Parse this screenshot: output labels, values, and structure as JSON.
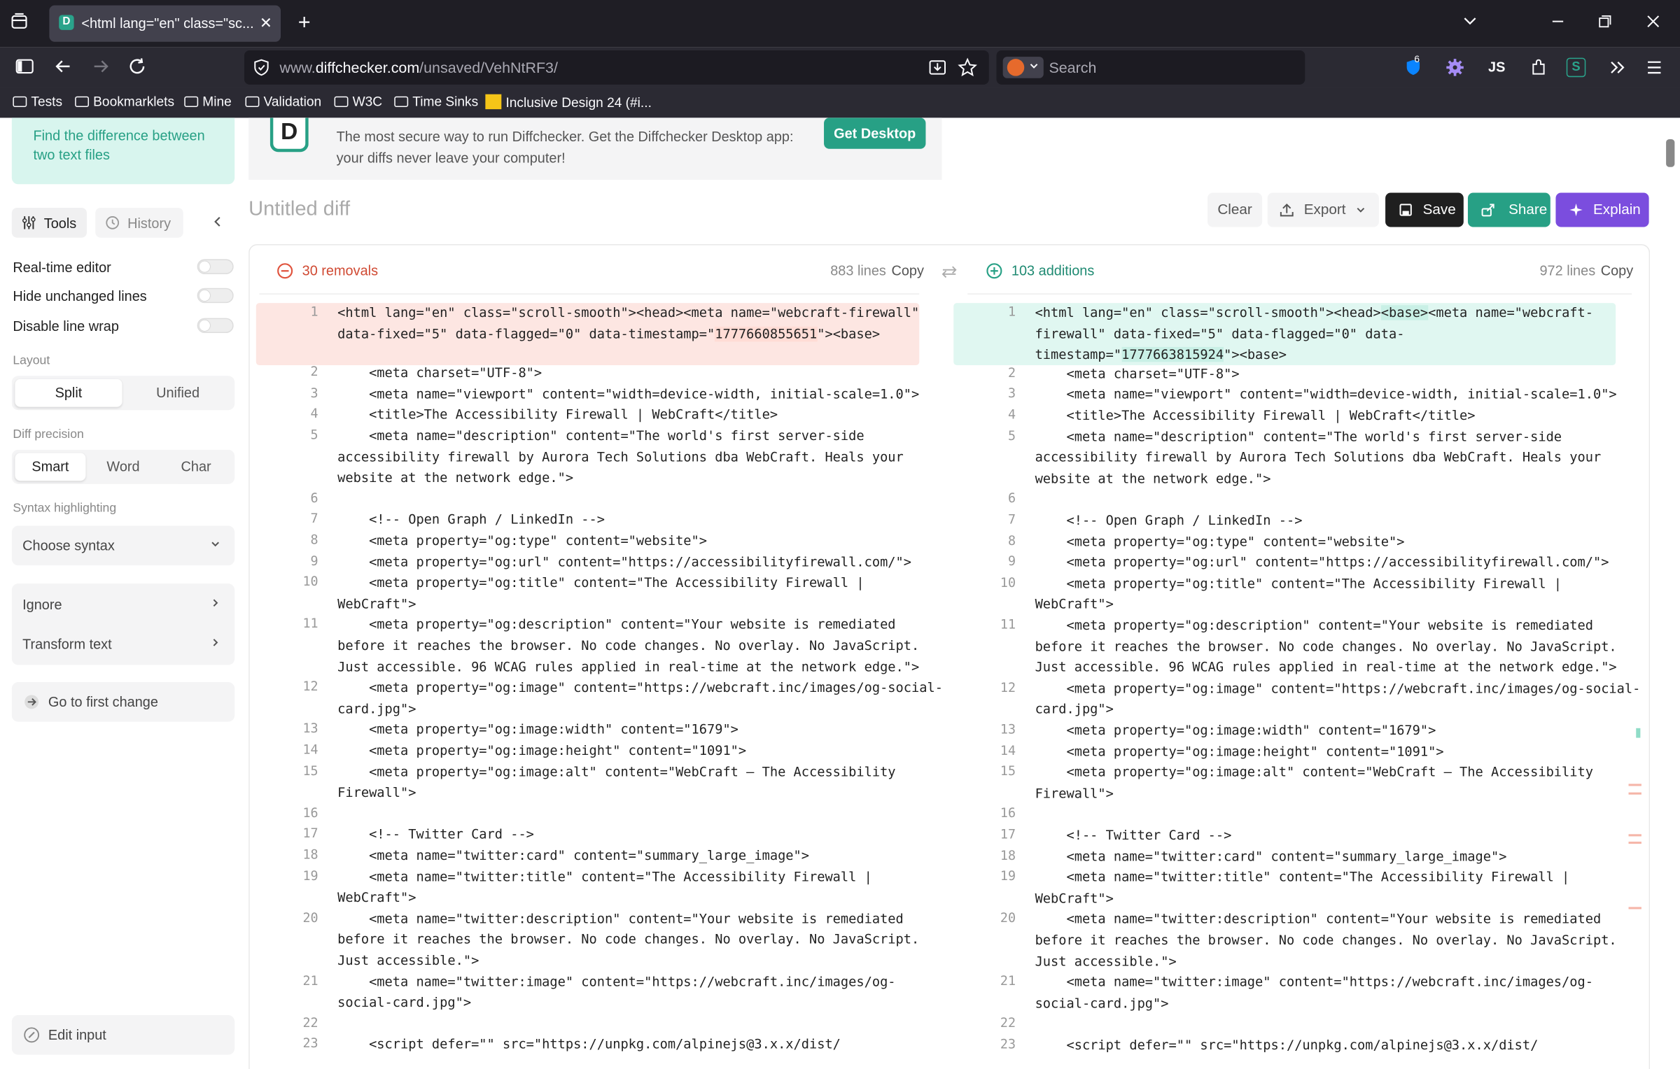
{
  "browser": {
    "tab_title": "<html lang=\"en\" class=\"sc... ↔",
    "url_prefix": "www.",
    "url_domain": "diffchecker.com",
    "url_path": "/unsaved/VehNtRF3/",
    "search_placeholder": "Search",
    "ext_badge": "6",
    "bookmarks": [
      "Tests",
      "Bookmarklets",
      "Mine",
      "Validation",
      "W3C",
      "Time Sinks",
      "Inclusive Design 24 (#i..."
    ]
  },
  "sidebar": {
    "promo_text": "Find the difference between two text files",
    "tools_label": "Tools",
    "history_label": "History",
    "toggles": [
      "Real-time editor",
      "Hide unchanged lines",
      "Disable line wrap"
    ],
    "layout_label": "Layout",
    "layout_options": [
      "Split",
      "Unified"
    ],
    "precision_label": "Diff precision",
    "precision_options": [
      "Smart",
      "Word",
      "Char"
    ],
    "syntax_label": "Syntax highlighting",
    "syntax_select": "Choose syntax",
    "ignore_label": "Ignore",
    "transform_label": "Transform text",
    "first_change_label": "Go to first change",
    "edit_input_label": "Edit input"
  },
  "banner": {
    "text": "The most secure way to run Diffchecker. Get the Diffchecker Desktop app: your diffs never leave your computer!",
    "button": "Get Desktop"
  },
  "header": {
    "title": "Untitled diff",
    "clear": "Clear",
    "export": "Export",
    "save": "Save",
    "share": "Share",
    "explain": "Explain"
  },
  "left_pane": {
    "summary": "30 removals",
    "lines": "883 lines",
    "copy": "Copy"
  },
  "right_pane": {
    "summary": "103 additions",
    "lines": "972 lines",
    "copy": "Copy"
  },
  "left_rows": [
    {
      "n": "1",
      "lines": [
        "<html lang=\"en\" class=\"scroll-smooth\"><head><meta name=\"webcraft-firewall\"",
        "data-fixed=\"5\" data-flagged=\"0\" data-timestamp=\"1777660855651\"><base>"
      ]
    },
    {
      "n": "2",
      "lines": [
        "    <meta charset=\"UTF-8\">"
      ]
    },
    {
      "n": "3",
      "lines": [
        "    <meta name=\"viewport\" content=\"width=device-width, initial-scale=1.0\">"
      ]
    },
    {
      "n": "4",
      "lines": [
        "    <title>The Accessibility Firewall | WebCraft</title>"
      ]
    },
    {
      "n": "5",
      "lines": [
        "    <meta name=\"description\" content=\"The world's first server-side",
        "accessibility firewall by Aurora Tech Solutions dba WebCraft. Heals your",
        "website at the network edge.\">"
      ]
    },
    {
      "n": "6",
      "lines": [
        ""
      ]
    },
    {
      "n": "7",
      "lines": [
        "    <!-- Open Graph / LinkedIn -->"
      ]
    },
    {
      "n": "8",
      "lines": [
        "    <meta property=\"og:type\" content=\"website\">"
      ]
    },
    {
      "n": "9",
      "lines": [
        "    <meta property=\"og:url\" content=\"https://accessibilityfirewall.com/\">"
      ]
    },
    {
      "n": "10",
      "lines": [
        "    <meta property=\"og:title\" content=\"The Accessibility Firewall |",
        "WebCraft\">"
      ]
    },
    {
      "n": "11",
      "lines": [
        "    <meta property=\"og:description\" content=\"Your website is remediated",
        "before it reaches the browser. No code changes. No overlay. No JavaScript.",
        "Just accessible. 96 WCAG rules applied in real-time at the network edge.\">"
      ]
    },
    {
      "n": "12",
      "lines": [
        "    <meta property=\"og:image\" content=\"https://webcraft.inc/images/og-social-",
        "card.jpg\">"
      ]
    },
    {
      "n": "13",
      "lines": [
        "    <meta property=\"og:image:width\" content=\"1679\">"
      ]
    },
    {
      "n": "14",
      "lines": [
        "    <meta property=\"og:image:height\" content=\"1091\">"
      ]
    },
    {
      "n": "15",
      "lines": [
        "    <meta property=\"og:image:alt\" content=\"WebCraft — The Accessibility",
        "Firewall\">"
      ]
    },
    {
      "n": "16",
      "lines": [
        ""
      ]
    },
    {
      "n": "17",
      "lines": [
        "    <!-- Twitter Card -->"
      ]
    },
    {
      "n": "18",
      "lines": [
        "    <meta name=\"twitter:card\" content=\"summary_large_image\">"
      ]
    },
    {
      "n": "19",
      "lines": [
        "    <meta name=\"twitter:title\" content=\"The Accessibility Firewall |",
        "WebCraft\">"
      ]
    },
    {
      "n": "20",
      "lines": [
        "    <meta name=\"twitter:description\" content=\"Your website is remediated",
        "before it reaches the browser. No code changes. No overlay. No JavaScript.",
        "Just accessible.\">"
      ]
    },
    {
      "n": "21",
      "lines": [
        "    <meta name=\"twitter:image\" content=\"https://webcraft.inc/images/og-",
        "social-card.jpg\">"
      ]
    },
    {
      "n": "22",
      "lines": [
        ""
      ]
    },
    {
      "n": "23",
      "lines": [
        "    <script defer=\"\" src=\"https://unpkg.com/alpinejs@3.x.x/dist/"
      ]
    }
  ],
  "right_rows": [
    {
      "n": "1",
      "lines": [
        "<html lang=\"en\" class=\"scroll-smooth\"><head><base><meta name=\"webcraft-",
        "firewall\" data-fixed=\"5\" data-flagged=\"0\" data-",
        "timestamp=\"1777663815924\"><base>"
      ]
    },
    {
      "n": "2",
      "lines": [
        "    <meta charset=\"UTF-8\">"
      ]
    },
    {
      "n": "3",
      "lines": [
        "    <meta name=\"viewport\" content=\"width=device-width, initial-scale=1.0\">"
      ]
    },
    {
      "n": "4",
      "lines": [
        "    <title>The Accessibility Firewall | WebCraft</title>"
      ]
    },
    {
      "n": "5",
      "lines": [
        "    <meta name=\"description\" content=\"The world's first server-side",
        "accessibility firewall by Aurora Tech Solutions dba WebCraft. Heals your",
        "website at the network edge.\">"
      ]
    },
    {
      "n": "6",
      "lines": [
        ""
      ]
    },
    {
      "n": "7",
      "lines": [
        "    <!-- Open Graph / LinkedIn -->"
      ]
    },
    {
      "n": "8",
      "lines": [
        "    <meta property=\"og:type\" content=\"website\">"
      ]
    },
    {
      "n": "9",
      "lines": [
        "    <meta property=\"og:url\" content=\"https://accessibilityfirewall.com/\">"
      ]
    },
    {
      "n": "10",
      "lines": [
        "    <meta property=\"og:title\" content=\"The Accessibility Firewall |",
        "WebCraft\">"
      ]
    },
    {
      "n": "11",
      "lines": [
        "    <meta property=\"og:description\" content=\"Your website is remediated",
        "before it reaches the browser. No code changes. No overlay. No JavaScript.",
        "Just accessible. 96 WCAG rules applied in real-time at the network edge.\">"
      ]
    },
    {
      "n": "12",
      "lines": [
        "    <meta property=\"og:image\" content=\"https://webcraft.inc/images/og-social-",
        "card.jpg\">"
      ]
    },
    {
      "n": "13",
      "lines": [
        "    <meta property=\"og:image:width\" content=\"1679\">"
      ]
    },
    {
      "n": "14",
      "lines": [
        "    <meta property=\"og:image:height\" content=\"1091\">"
      ]
    },
    {
      "n": "15",
      "lines": [
        "    <meta property=\"og:image:alt\" content=\"WebCraft — The Accessibility",
        "Firewall\">"
      ]
    },
    {
      "n": "16",
      "lines": [
        ""
      ]
    },
    {
      "n": "17",
      "lines": [
        "    <!-- Twitter Card -->"
      ]
    },
    {
      "n": "18",
      "lines": [
        "    <meta name=\"twitter:card\" content=\"summary_large_image\">"
      ]
    },
    {
      "n": "19",
      "lines": [
        "    <meta name=\"twitter:title\" content=\"The Accessibility Firewall |",
        "WebCraft\">"
      ]
    },
    {
      "n": "20",
      "lines": [
        "    <meta name=\"twitter:description\" content=\"Your website is remediated",
        "before it reaches the browser. No code changes. No overlay. No JavaScript.",
        "Just accessible.\">"
      ]
    },
    {
      "n": "21",
      "lines": [
        "    <meta name=\"twitter:image\" content=\"https://webcraft.inc/images/og-",
        "social-card.jpg\">"
      ]
    },
    {
      "n": "22",
      "lines": [
        ""
      ]
    },
    {
      "n": "23",
      "lines": [
        "    <script defer=\"\" src=\"https://unpkg.com/alpinejs@3.x.x/dist/"
      ]
    }
  ],
  "colors": {
    "accent": "#27a085",
    "removal": "#e0533d",
    "save_btn": "#1f1f1f",
    "explain_btn": "#7b4dde"
  }
}
